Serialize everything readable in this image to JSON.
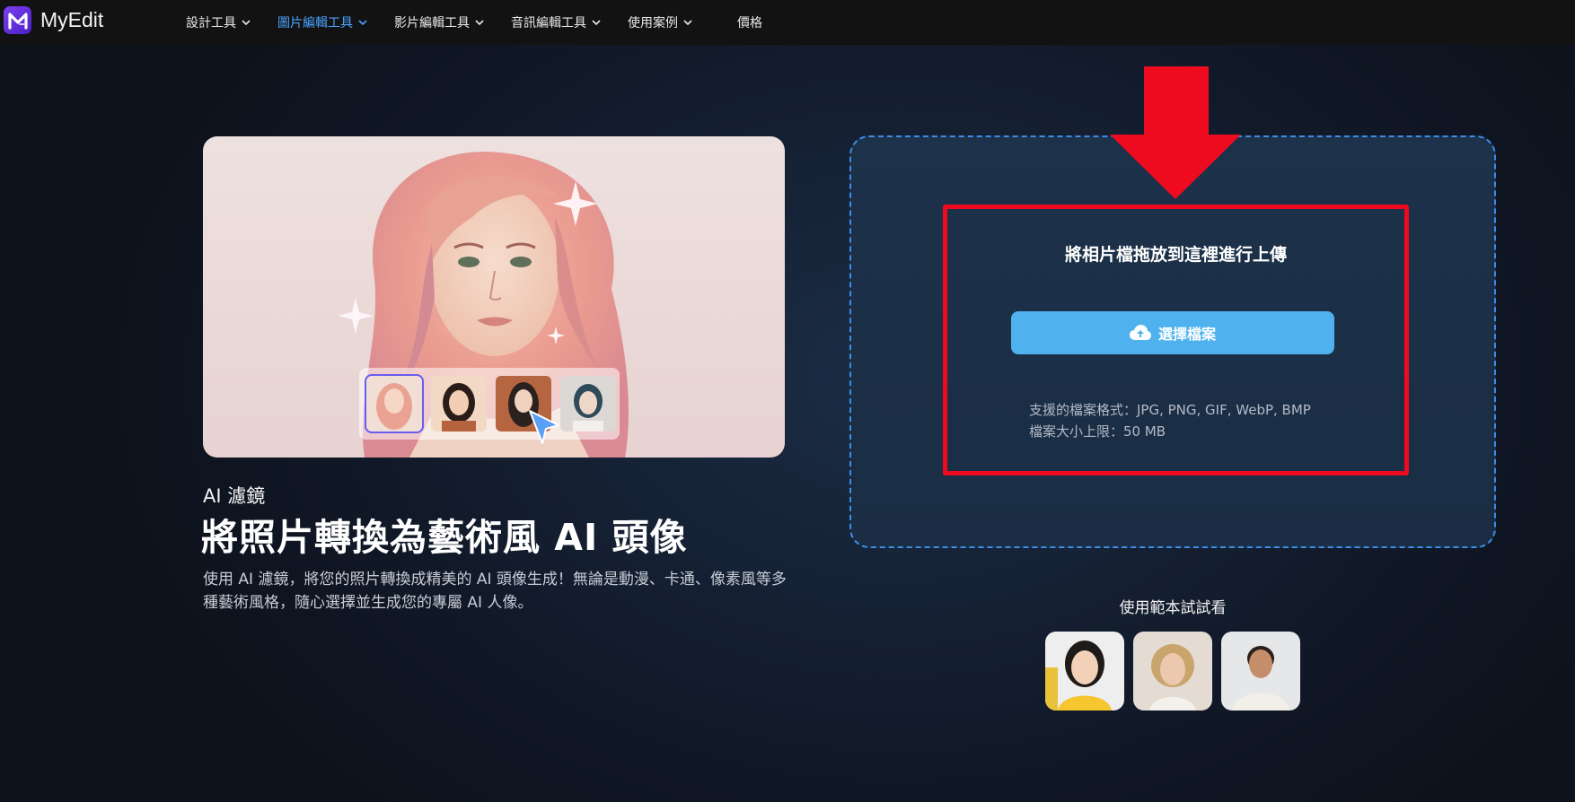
{
  "brand": {
    "name": "MyEdit",
    "logo_letter": "M"
  },
  "nav": {
    "items": [
      {
        "label": "設計工具",
        "has_menu": true,
        "active": false
      },
      {
        "label": "圖片編輯工具",
        "has_menu": true,
        "active": true
      },
      {
        "label": "影片編輯工具",
        "has_menu": true,
        "active": false
      },
      {
        "label": "音訊編輯工具",
        "has_menu": true,
        "active": false
      },
      {
        "label": "使用案例",
        "has_menu": true,
        "active": false
      }
    ],
    "pricing_label": "價格"
  },
  "hero": {
    "kicker": "AI 濾鏡",
    "headline": "將照片轉換為藝術風 AI 頭像",
    "description": "使用 AI 濾鏡，將您的照片轉換成精美的 AI 頭像生成！無論是動漫、卡通、像素風等多種藝術風格，隨心選擇並生成您的專屬 AI 人像。"
  },
  "upload": {
    "drop_title": "將相片檔拖放到這裡進行上傳",
    "choose_label": "選擇檔案",
    "formats_line": "支援的檔案格式：JPG, PNG, GIF, WebP, BMP",
    "size_line": "檔案大小上限：50 MB"
  },
  "samples": {
    "title": "使用範本試試看",
    "items": [
      "sample-photo-1",
      "sample-photo-2",
      "sample-photo-3"
    ]
  },
  "colors": {
    "accent": "#4aa3ff",
    "button": "#4fb2ee",
    "highlight": "#ee0a1f",
    "dash_border": "#3c8de6"
  }
}
